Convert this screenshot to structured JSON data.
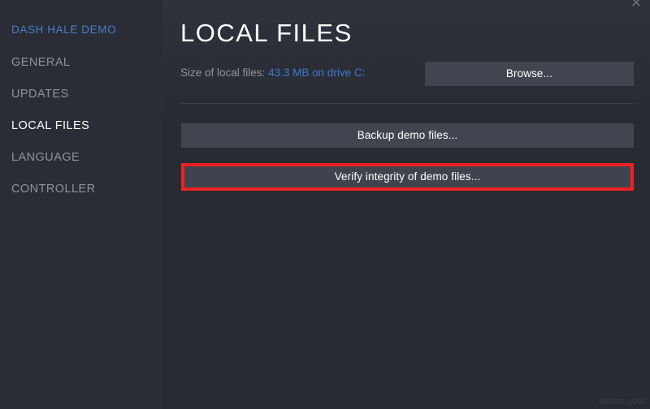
{
  "window": {
    "close_label": "✕",
    "watermark": "wsxdn.com"
  },
  "sidebar": {
    "app_title": "DASH HALE DEMO",
    "items": [
      {
        "label": "GENERAL",
        "active": false
      },
      {
        "label": "UPDATES",
        "active": false
      },
      {
        "label": "LOCAL FILES",
        "active": true
      },
      {
        "label": "LANGUAGE",
        "active": false
      },
      {
        "label": "CONTROLLER",
        "active": false
      }
    ]
  },
  "main": {
    "page_title": "LOCAL FILES",
    "size_label": "Size of local files:",
    "size_value": "43.3 MB on drive C:",
    "buttons": {
      "browse": "Browse...",
      "backup": "Backup demo files...",
      "verify": "Verify integrity of demo files..."
    }
  },
  "colors": {
    "accent_blue": "#4a7dc9",
    "link_blue": "#3f7ad0",
    "highlight_red": "#ee2024",
    "sidebar_bg": "#2a2d36",
    "content_bg": "#282b33",
    "button_bg": "#41454f"
  }
}
